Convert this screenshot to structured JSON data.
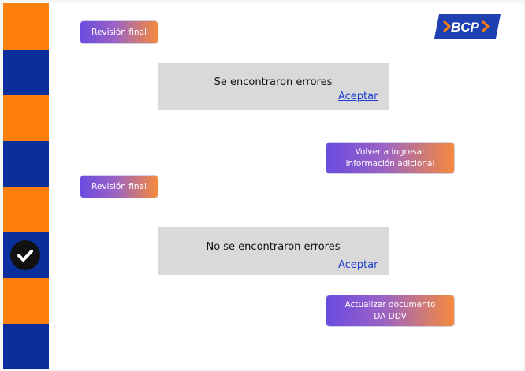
{
  "sidebar": {
    "colors": [
      "#ff7f0e",
      "#0a2f9c",
      "#ff7f0e",
      "#0a2f9c",
      "#ff7f0e",
      "#0a2f9c",
      "#ff7f0e",
      "#0a2f9c"
    ],
    "status_icon": "check-circle-icon"
  },
  "logo": {
    "text": "BCP",
    "brand_color": "#1e40b0",
    "accent_color": "#ff7f0e"
  },
  "steps": {
    "review_1_label": "Revisión final",
    "review_2_label": "Revisión final",
    "reenter_label": "Volver a ingresar información adicional",
    "update_label": "Actualizar documento DA DDV"
  },
  "dialogs": {
    "errors": {
      "message": "Se encontraron errores",
      "action": "Aceptar"
    },
    "no_errors": {
      "message": "No se encontraron errores",
      "action": "Aceptar"
    }
  }
}
